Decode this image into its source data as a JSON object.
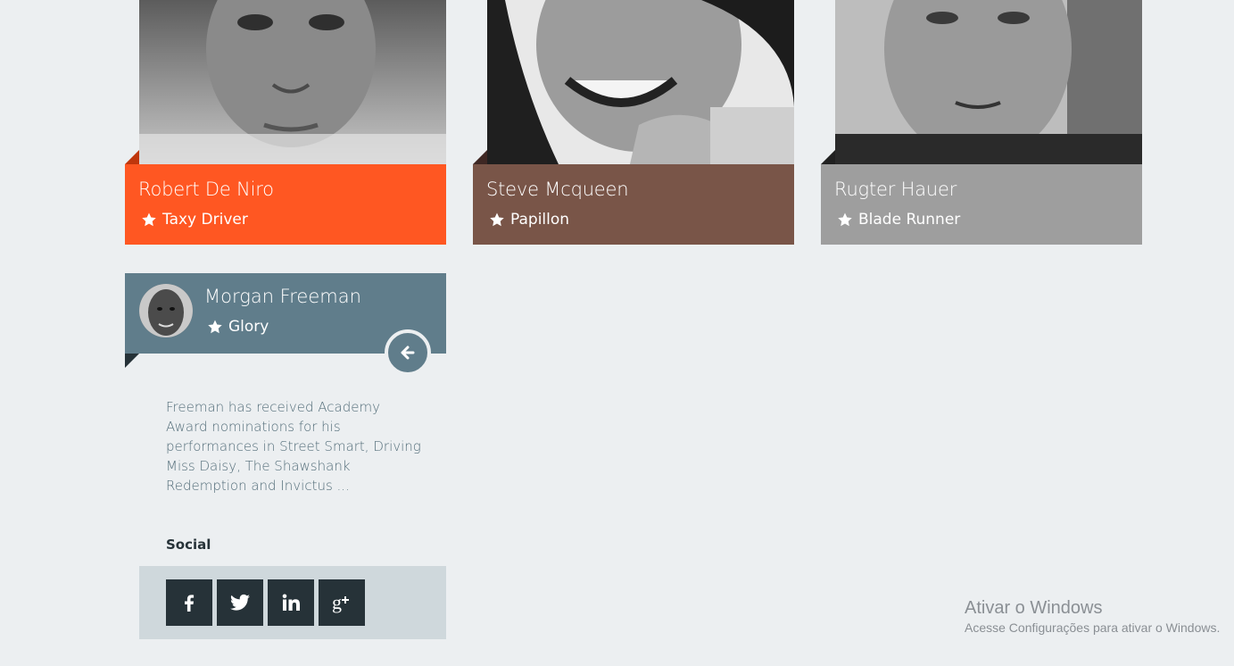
{
  "cards": [
    {
      "name": "Robert De Niro",
      "movie": "Taxy Driver",
      "color": "#ff5722",
      "fold": "#bf360c"
    },
    {
      "name": "Steve Mcqueen",
      "movie": "Papillon",
      "color": "#795548",
      "fold": "#3e2723"
    },
    {
      "name": "Rugter Hauer",
      "movie": "Blade Runner",
      "color": "#9e9e9e",
      "fold": "#212121"
    }
  ],
  "expanded": {
    "name": "Morgan Freeman",
    "movie": "Glory",
    "bio": "Freeman has received Academy Award nominations for his performances in Street Smart, Driving Miss Daisy, The Shawshank Redemption and Invictus ...",
    "social_title": "Social",
    "social": [
      "facebook-icon",
      "twitter-icon",
      "linkedin-icon",
      "google-plus-icon"
    ]
  },
  "windows": {
    "title": "Ativar o Windows",
    "subtitle": "Acesse Configurações para ativar o Windows."
  }
}
